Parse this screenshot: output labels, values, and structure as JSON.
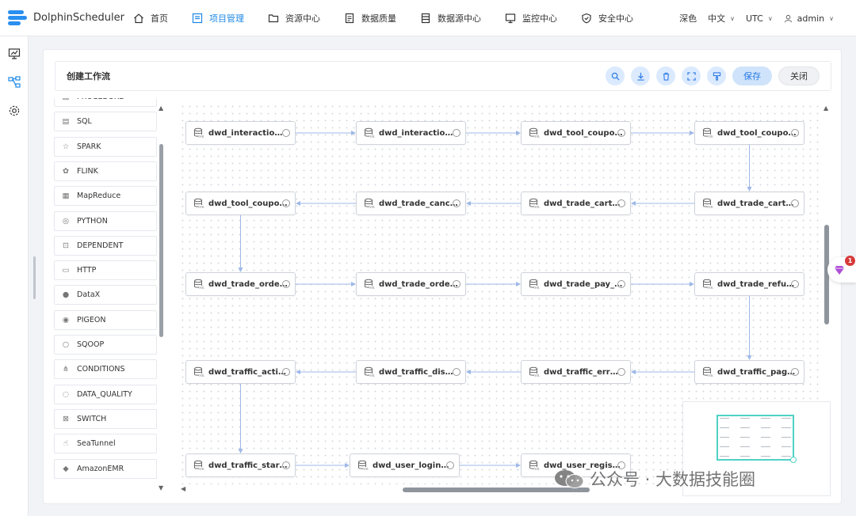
{
  "app": {
    "name": "DolphinScheduler"
  },
  "nav": [
    {
      "label": "首页",
      "icon": "home-icon",
      "active": false
    },
    {
      "label": "项目管理",
      "icon": "project-icon",
      "active": true
    },
    {
      "label": "资源中心",
      "icon": "folder-icon",
      "active": false
    },
    {
      "label": "数据质量",
      "icon": "data-quality-icon",
      "active": false
    },
    {
      "label": "数据源中心",
      "icon": "datasource-icon",
      "active": false
    },
    {
      "label": "监控中心",
      "icon": "monitor-icon",
      "active": false
    },
    {
      "label": "安全中心",
      "icon": "shield-icon",
      "active": false
    }
  ],
  "header_right": {
    "theme": "深色",
    "language": "中文",
    "timezone": "UTC",
    "user": "admin"
  },
  "card": {
    "title": "创建工作流",
    "save_label": "保存",
    "close_label": "关闭"
  },
  "toolbar_icons": [
    "search-icon",
    "download-icon",
    "delete-icon",
    "fullscreen-icon",
    "format-icon"
  ],
  "palette": [
    "PROCEDURE",
    "SQL",
    "SPARK",
    "FLINK",
    "MapReduce",
    "PYTHON",
    "DEPENDENT",
    "HTTP",
    "DataX",
    "PIGEON",
    "SQOOP",
    "CONDITIONS",
    "DATA_QUALITY",
    "SWITCH",
    "SeaTunnel",
    "AmazonEMR"
  ],
  "nodes": [
    "dwd_interaction_co...",
    "dwd_interaction_fa...",
    "dwd_tool_coupon_g...",
    "dwd_tool_coupon_o...",
    "dwd_tool_coupon_p...",
    "dwd_trade_cancel_d...",
    "dwd_trade_cart_add...",
    "dwd_trade_cart_ful...",
    "dwd_trade_order_de...",
    "dwd_trade_order_re...",
    "dwd_trade_pay_deta...",
    "dwd_trade_refund_p...",
    "dwd_traffic_action...",
    "dwd_traffic_displa...",
    "dwd_traffic_error_...",
    "dwd_traffic_page_v...",
    "dwd_traffic_start_...",
    "dwd_user_login_inc...",
    "dwd_user_register_..."
  ],
  "float_badge": "1",
  "watermark": "公众号 · 大数据技能圈",
  "colors": {
    "accent": "#1e88e5",
    "edge": "#9db8e8",
    "minimap_view": "#4fd1c5"
  }
}
